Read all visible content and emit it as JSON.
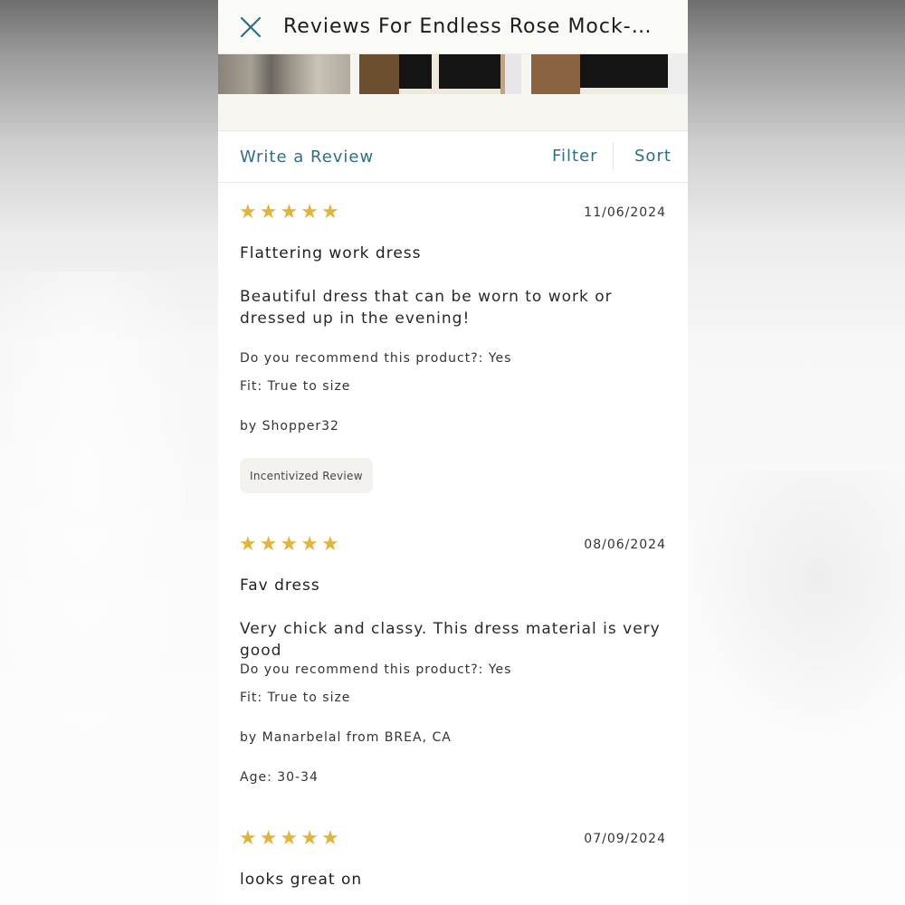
{
  "header": {
    "title": "Reviews For Endless Rose Mock-Neck..."
  },
  "toolbar": {
    "write_review": "Write a Review",
    "filter": "Filter",
    "sort": "Sort"
  },
  "colors": {
    "accent_link": "#2f6f86",
    "star": "#e3b43c"
  },
  "reviews": [
    {
      "rating": 5,
      "date": "11/06/2024",
      "title": "Flattering work dress",
      "body": "Beautiful dress that can be worn to work or dressed up in the evening!",
      "recommend": "Do you recommend this product?: Yes",
      "fit": "Fit: True to size",
      "author": "by Shopper32",
      "badge": "Incentivized Review"
    },
    {
      "rating": 5,
      "date": "08/06/2024",
      "title": "Fav dress",
      "body": "Very chick and classy. This dress material is very good",
      "recommend": "Do you recommend this product?: Yes",
      "fit": "Fit: True to size",
      "author": "by Manarbelal from BREA, CA",
      "age": "Age: 30-34"
    },
    {
      "rating": 5,
      "date": "07/09/2024",
      "title": "looks great on"
    }
  ]
}
